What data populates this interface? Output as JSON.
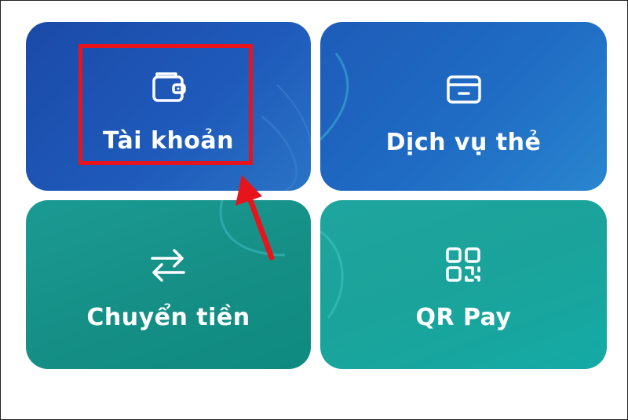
{
  "menu": {
    "account": {
      "label": "Tài khoản",
      "icon": "wallet-icon"
    },
    "card_services": {
      "label": "Dịch vụ thẻ",
      "icon": "credit-card-icon"
    },
    "transfer": {
      "label": "Chuyển tiền",
      "icon": "transfer-arrows-icon"
    },
    "qr_pay": {
      "label": "QR Pay",
      "icon": "qr-code-icon"
    }
  },
  "colors": {
    "top_tiles": "#1f5bbb",
    "bottom_tiles": "#169087",
    "highlight": "#e8141b",
    "text": "#ffffff"
  }
}
